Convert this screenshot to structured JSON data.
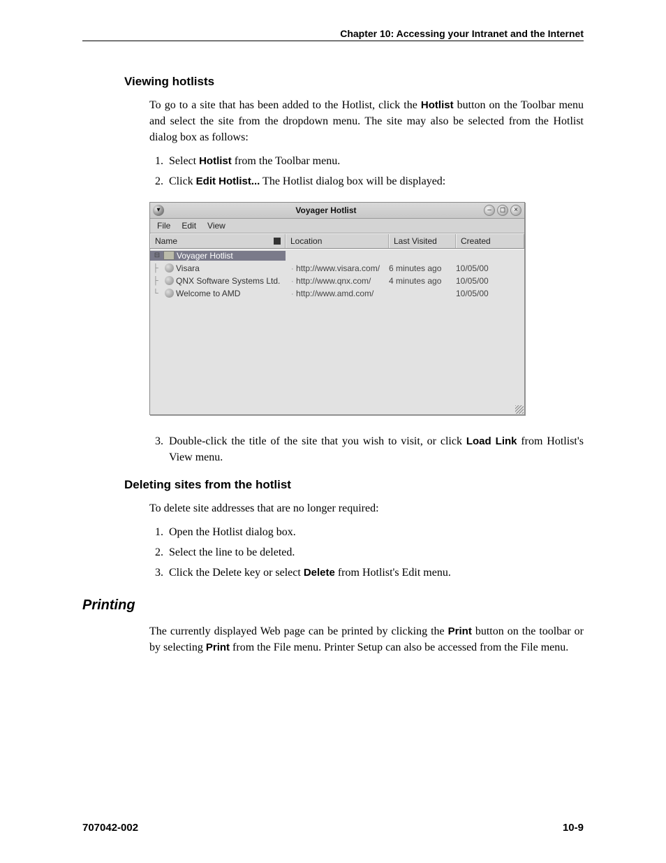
{
  "header": "Chapter 10: Accessing your Intranet and the Internet",
  "section1": {
    "heading": "Viewing hotlists",
    "intro_a": "To go to a site that has been added to the Hotlist, click the ",
    "intro_bold": "Hotlist",
    "intro_b": " button on the Toolbar menu and select the site from the dropdown menu. The site may also be selected from the Hotlist dialog box as follows:",
    "step1_a": "Select ",
    "step1_bold": "Hotlist",
    "step1_b": " from the Toolbar menu.",
    "step2_a": "Click ",
    "step2_bold": "Edit Hotlist...",
    "step2_b": " The Hotlist dialog box will be displayed:",
    "step3_a": "Double-click the title of the site that you wish to visit, or click ",
    "step3_bold": "Load Link",
    "step3_b": " from Hotlist's View menu."
  },
  "dialog": {
    "title": "Voyager Hotlist",
    "menu": {
      "file": "File",
      "edit": "Edit",
      "view": "View"
    },
    "cols": {
      "name": "Name",
      "location": "Location",
      "last": "Last Visited",
      "created": "Created"
    },
    "root": "Voyager Hotlist",
    "rows": [
      {
        "name": "Visara",
        "loc": "http://www.visara.com/",
        "last": "6 minutes ago",
        "created": "10/05/00"
      },
      {
        "name": "QNX Software Systems Ltd.",
        "loc": "http://www.qnx.com/",
        "last": "4 minutes ago",
        "created": "10/05/00"
      },
      {
        "name": "Welcome to AMD",
        "loc": "http://www.amd.com/",
        "last": "",
        "created": "10/05/00"
      }
    ]
  },
  "section2": {
    "heading": "Deleting sites from the hotlist",
    "intro": "To delete site addresses that are no longer required:",
    "step1": "Open the Hotlist dialog box.",
    "step2": "Select the line to be deleted.",
    "step3_a": "Click the Delete key or select ",
    "step3_bold": "Delete",
    "step3_b": " from Hotlist's Edit menu."
  },
  "section3": {
    "heading": "Printing",
    "para_a": "The currently displayed Web page can be printed by clicking the ",
    "para_bold1": "Print",
    "para_b": " button on the toolbar or by selecting ",
    "para_bold2": "Print",
    "para_c": " from the File menu. Printer Setup can also be accessed from the File menu."
  },
  "footer": {
    "left": "707042-002",
    "right": "10-9"
  }
}
